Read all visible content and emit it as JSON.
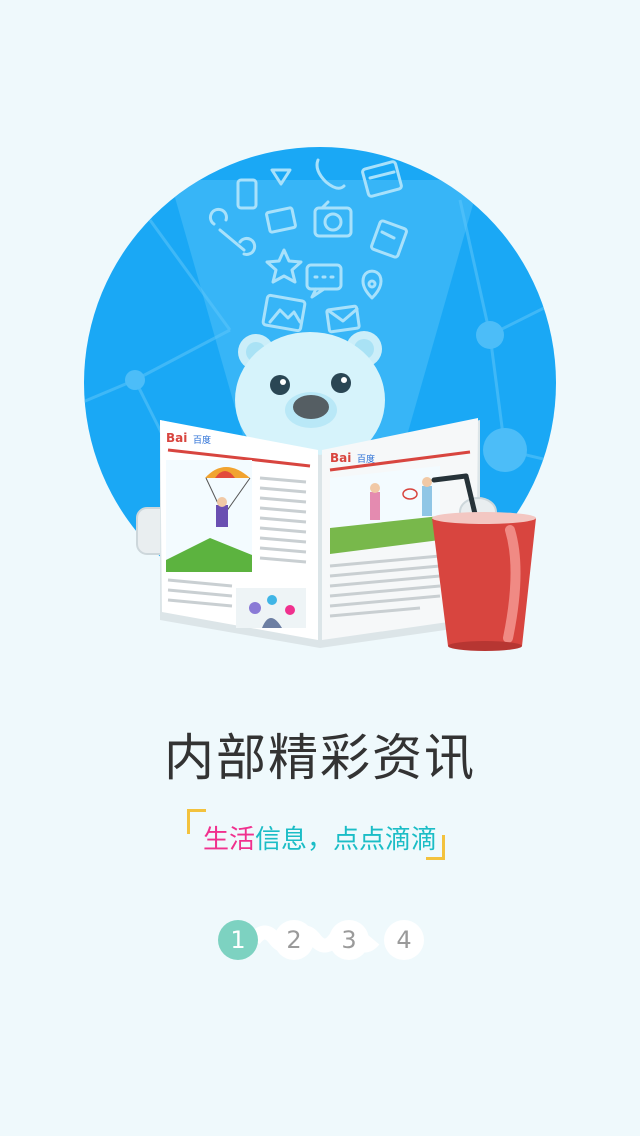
{
  "title": "内部精彩资讯",
  "subtitle": {
    "part1": "生活",
    "part2": "信息，点点滴滴"
  },
  "pager": {
    "pages": [
      "1",
      "2",
      "3",
      "4"
    ],
    "active_index": 0
  },
  "newspaper": {
    "logo_text": "Bai",
    "logo_suffix": "百度"
  },
  "colors": {
    "background": "#eff9fc",
    "circle": "#1aa8f5",
    "pink": "#f0318e",
    "teal": "#1bbdc6",
    "accent_yellow": "#f3c23d",
    "active_dot": "#7dd2c1",
    "cup_red": "#d8453f"
  }
}
